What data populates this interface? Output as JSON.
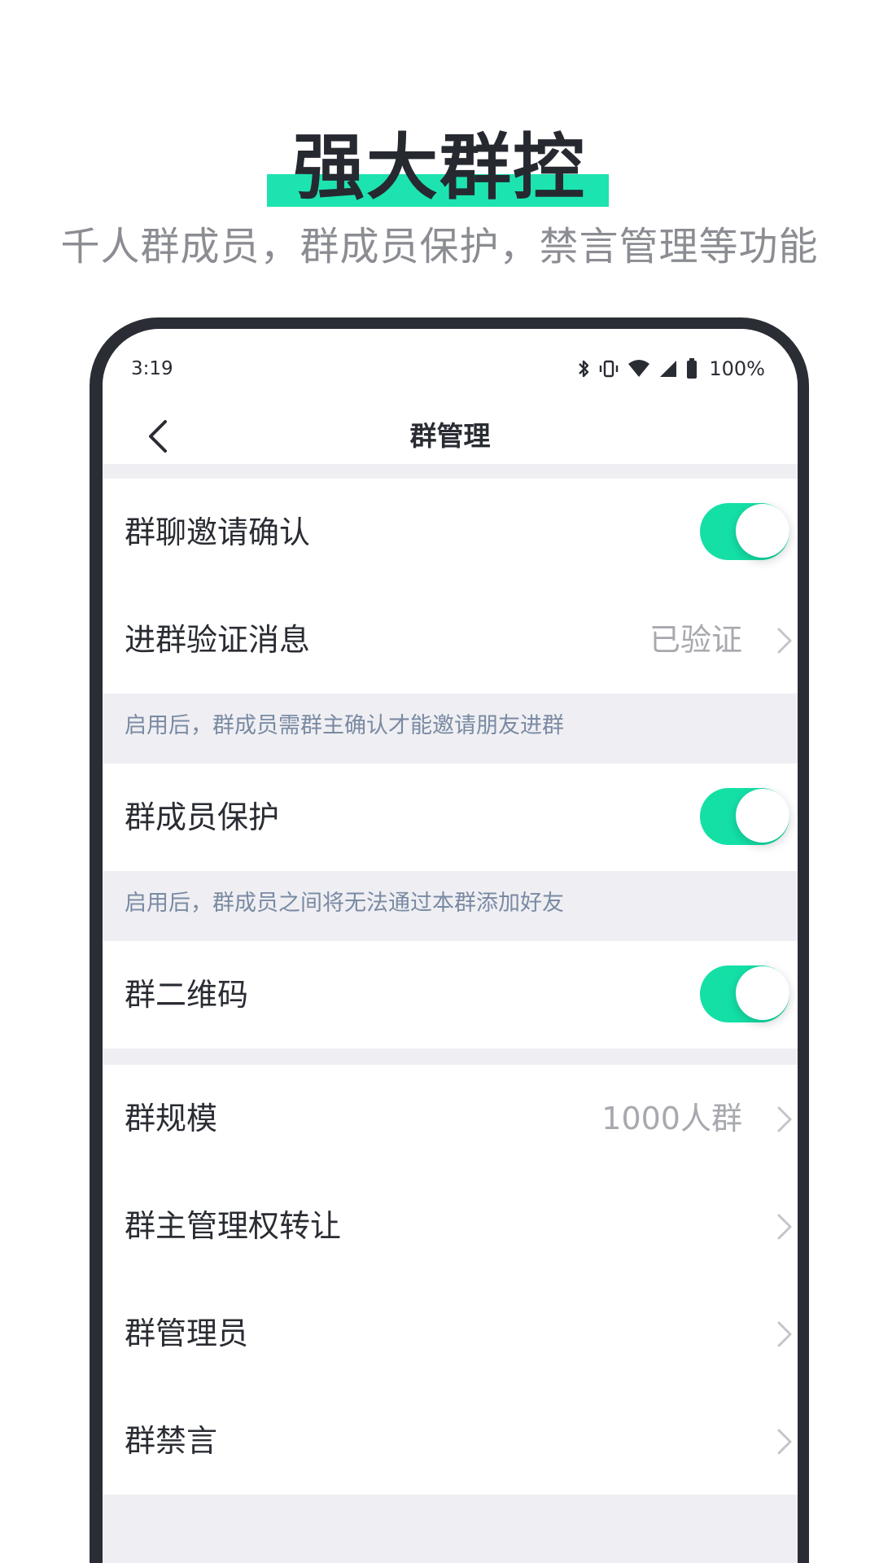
{
  "promo": {
    "title": "强大群控",
    "subtitle": "千人群成员，群成员保护，禁言管理等功能",
    "highlight_color": "#1de3b0"
  },
  "status_bar": {
    "time": "3:19",
    "battery": "100%",
    "icons": [
      "bluetooth-icon",
      "vibrate-icon",
      "wifi-icon",
      "signal-icon",
      "battery-icon"
    ]
  },
  "nav": {
    "title": "群管理",
    "back_icon": "chevron-left-icon"
  },
  "settings": {
    "invite_confirm": {
      "label": "群聊邀请确认",
      "enabled": true
    },
    "join_verify": {
      "label": "进群验证消息",
      "value": "已验证"
    },
    "hint_invite": "启用后，群成员需群主确认才能邀请朋友进群",
    "member_protect": {
      "label": "群成员保护",
      "enabled": true
    },
    "hint_protect": "启用后，群成员之间将无法通过本群添加好友",
    "qr_code": {
      "label": "群二维码",
      "enabled": true
    },
    "group_size": {
      "label": "群规模",
      "value": "1000人群"
    },
    "transfer_owner": {
      "label": "群主管理权转让"
    },
    "admins": {
      "label": "群管理员"
    },
    "mute": {
      "label": "群禁言"
    }
  },
  "colors": {
    "accent": "#14e0a6",
    "frame": "#2b2d35",
    "hint_text": "#7a8aa3",
    "section_bg": "#efeff3"
  }
}
